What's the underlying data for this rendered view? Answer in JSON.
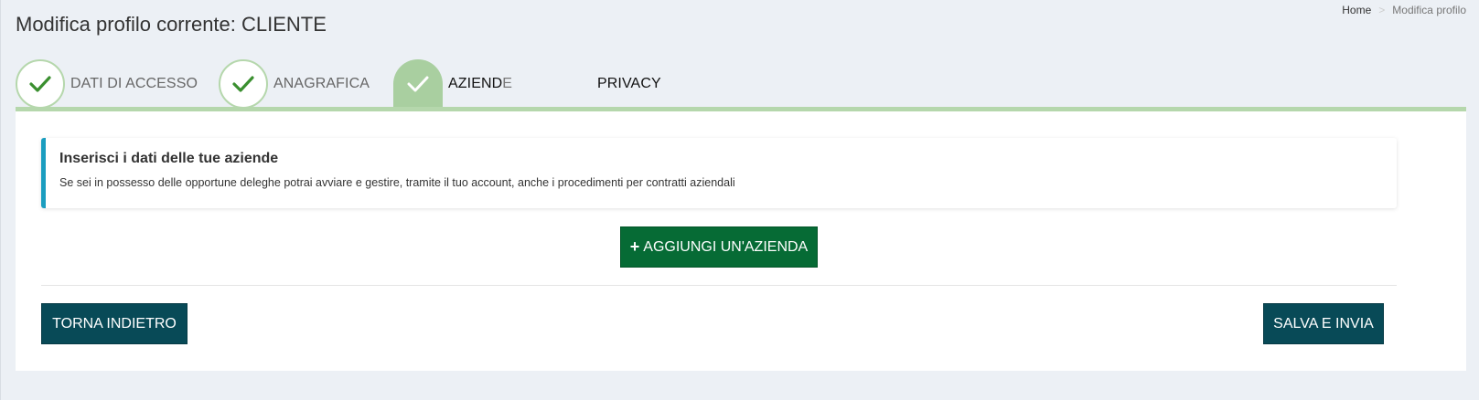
{
  "header": {
    "title": "Modifica profilo corrente: CLIENTE",
    "breadcrumb": {
      "home": "Home",
      "separator": ">",
      "current": "Modifica profilo"
    }
  },
  "steps": [
    {
      "label": "DATI DI ACCESSO",
      "status": "completed",
      "icon": "check-icon"
    },
    {
      "label": "ANAGRAFICA",
      "status": "completed",
      "icon": "check-icon"
    },
    {
      "label_main": "AZIEND",
      "label_tail": "E",
      "status": "active",
      "icon": "check-icon"
    },
    {
      "label": "PRIVACY",
      "status": "pending"
    }
  ],
  "callout": {
    "heading": "Inserisci i dati delle tue aziende",
    "text": "Se sei in possesso delle opportune deleghe potrai avviare e gestire, tramite il tuo account, anche i procedimenti per contratti aziendali"
  },
  "actions": {
    "add_company_icon": "+",
    "add_company": "AGGIUNGI UN'AZIENDA",
    "back": "TORNA INDIETRO",
    "save": "SALVA E INVIA"
  },
  "colors": {
    "background": "#ecf0f5",
    "step_completed_border": "#b5d7ac",
    "step_active": "#a9cfa0",
    "check_green": "#3a8f2f",
    "callout_accent": "#1a9dbf",
    "add_button": "#066b35",
    "nav_button": "#084a57"
  }
}
